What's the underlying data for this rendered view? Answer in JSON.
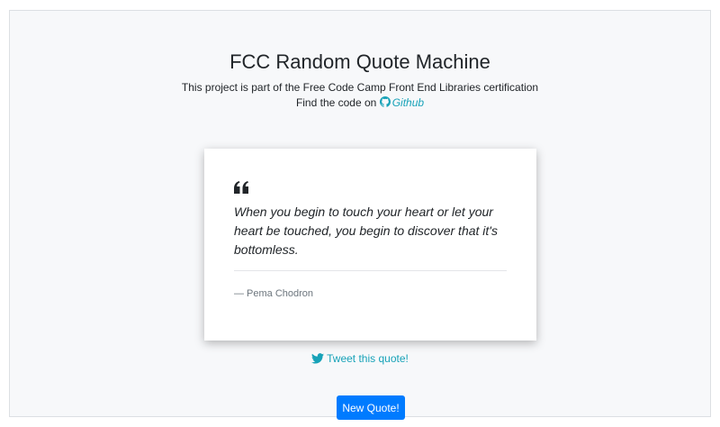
{
  "header": {
    "title": "FCC Random Quote Machine",
    "subtitle": "This project is part of the Free Code Camp Front End Libraries certification",
    "code_prefix": "Find the code on",
    "github_link": "Github"
  },
  "quote": {
    "text": "When you begin to touch your heart or let your heart be touched, you begin to discover that it's bottomless.",
    "author": "— Pema Chodron"
  },
  "actions": {
    "tweet_label": "Tweet this quote!",
    "new_quote_label": "New Quote!"
  },
  "icons": {
    "github": "github-icon",
    "twitter": "twitter-icon",
    "quote": "quote-left-icon"
  },
  "colors": {
    "accent": "#17a2b8",
    "button": "#007bff",
    "page_bg": "#f7f8fa",
    "card_bg": "#ffffff"
  }
}
